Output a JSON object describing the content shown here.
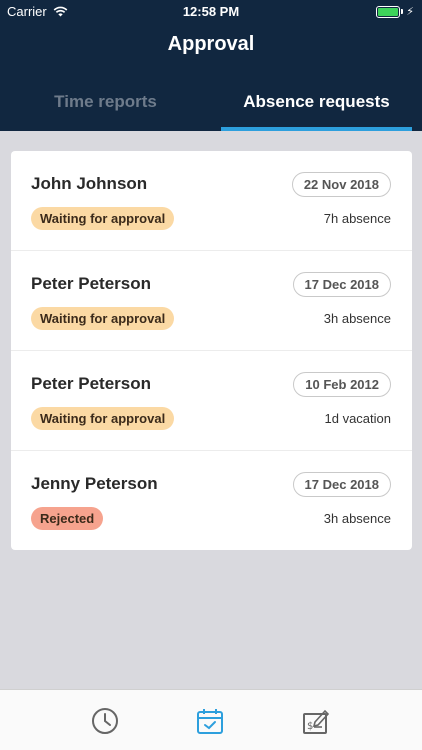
{
  "status_bar": {
    "carrier": "Carrier",
    "time": "12:58 PM"
  },
  "header": {
    "title": "Approval"
  },
  "tabs": [
    {
      "label": "Time reports",
      "active": false
    },
    {
      "label": "Absence requests",
      "active": true
    }
  ],
  "requests": [
    {
      "name": "John Johnson",
      "date": "22 Nov 2018",
      "status": "Waiting for approval",
      "detail": "7h absence"
    },
    {
      "name": "Peter Peterson",
      "date": "17 Dec 2018",
      "status": "Waiting for approval",
      "detail": "3h absence"
    },
    {
      "name": "Peter Peterson",
      "date": "10 Feb 2012",
      "status": "Waiting for approval",
      "detail": "1d vacation"
    },
    {
      "name": "Jenny Peterson",
      "date": "17 Dec 2018",
      "status": "Rejected",
      "detail": "3h absence"
    }
  ],
  "tab_bar": {
    "items": [
      "clock-icon",
      "calendar-check-icon",
      "expense-form-icon"
    ],
    "active": "calendar-check-icon"
  },
  "colors": {
    "header_bg": "#112740",
    "accent": "#2d9fdd",
    "waiting": "#fbd9a4",
    "rejected": "#f6a38e",
    "battery": "#3ed35b"
  }
}
